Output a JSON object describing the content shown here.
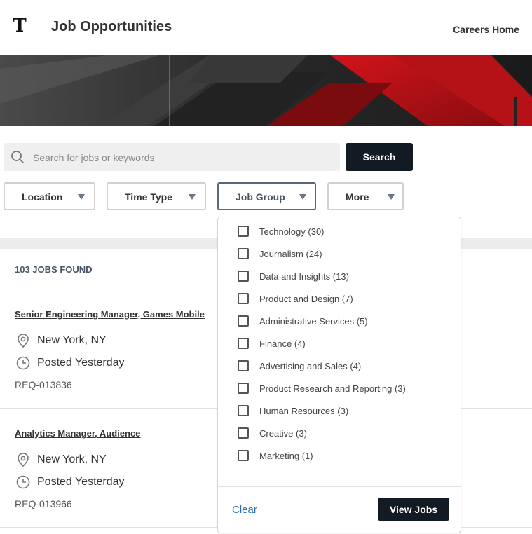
{
  "header": {
    "logo_letter": "T",
    "title": "Job Opportunities",
    "careers_home": "Careers Home"
  },
  "search": {
    "placeholder": "Search for jobs or keywords",
    "value": "",
    "button": "Search"
  },
  "filters": {
    "location": "Location",
    "time_type": "Time Type",
    "job_group": "Job Group",
    "more": "More"
  },
  "results": {
    "count_text": "103 JOBS FOUND",
    "jobs": [
      {
        "title": "Senior Engineering Manager, Games Mobile",
        "location": "New York, NY",
        "posted": "Posted Yesterday",
        "req": "REQ-013836"
      },
      {
        "title": "Analytics Manager, Audience",
        "location": "New York, NY",
        "posted": "Posted Yesterday",
        "req": "REQ-013966"
      }
    ]
  },
  "job_group_dropdown": {
    "options": [
      {
        "label": "Technology (30)",
        "checked": false
      },
      {
        "label": "Journalism (24)",
        "checked": false
      },
      {
        "label": "Data and Insights (13)",
        "checked": false
      },
      {
        "label": "Product and Design (7)",
        "checked": false
      },
      {
        "label": "Administrative Services (5)",
        "checked": false
      },
      {
        "label": "Finance (4)",
        "checked": false
      },
      {
        "label": "Advertising and Sales (4)",
        "checked": false
      },
      {
        "label": "Product Research and Reporting (3)",
        "checked": false
      },
      {
        "label": "Human Resources (3)",
        "checked": false
      },
      {
        "label": "Creative (3)",
        "checked": false
      },
      {
        "label": "Marketing (1)",
        "checked": false
      }
    ],
    "clear": "Clear",
    "view_jobs": "View Jobs"
  },
  "colors": {
    "primary_dark": "#121a24",
    "link_blue": "#2a73b8",
    "banner_red": "#c0141a"
  }
}
